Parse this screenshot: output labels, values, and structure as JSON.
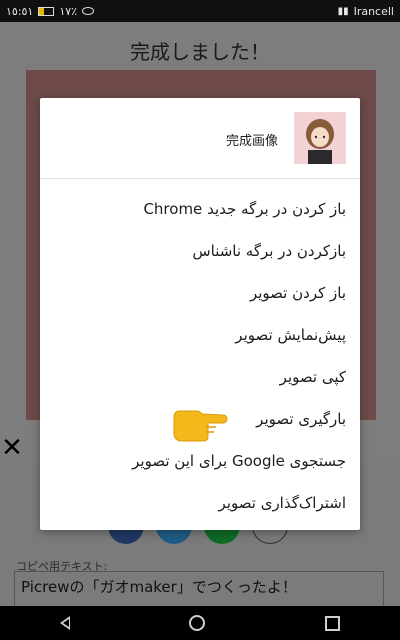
{
  "status_bar": {
    "time": "١٥:٥١",
    "battery": "١٧٪",
    "carrier": "Irancell",
    "signal_icon": "signal-icon"
  },
  "page": {
    "title": "完成しました！",
    "copy_label": "コピペ用テキスト:",
    "copy_text": "Picrewの「ガオmaker」でつくったよ！"
  },
  "dialog": {
    "title": "完成画像",
    "items": [
      {
        "label": "باز کردن در برگه جدید Chrome"
      },
      {
        "label": "بازکردن در برگه ناشناس"
      },
      {
        "label": "باز کردن تصویر"
      },
      {
        "label": "پیش‌نمایش تصویر"
      },
      {
        "label": "کپی تصویر"
      },
      {
        "label": "بارگیری تصویر"
      },
      {
        "label": "جستجوی Google برای این تصویر"
      },
      {
        "label": "اشتراک‌گذاری تصویر"
      }
    ]
  },
  "colors": {
    "dialog_bg": "#ffffff",
    "overlay": "#7d7d7d",
    "pointer": "#f5b81a"
  }
}
